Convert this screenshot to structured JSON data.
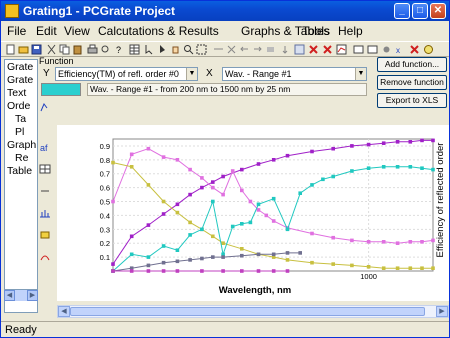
{
  "window": {
    "title": "Grating1 - PCGrate Project"
  },
  "title_buttons": {
    "minimize": "_",
    "maximize": "□",
    "close": "✕"
  },
  "menu": [
    "File",
    "Edit",
    "View",
    "Calcutations & Results",
    "Graphs & Tables",
    "Tools",
    "Help"
  ],
  "function_panel": {
    "group_label": "Function",
    "y_label": "Y",
    "y_select": "Efficiency(TM) of refl. order #0",
    "x_label": "X",
    "x_select": "Wav. - Range #1",
    "range_description": "Wav. - Range #1 - from 200 nm to 1500 nm by 25 nm",
    "series_color": "#2acfcf"
  },
  "side_buttons": {
    "add": "Add function...",
    "remove": "Remove function",
    "export": "Export to XLS"
  },
  "tree": [
    "Grate",
    "Grate",
    "Text",
    "Orde",
    "Ta",
    "Pl",
    "Graph",
    "Re",
    "Table"
  ],
  "status": {
    "text": "Ready"
  },
  "chart_data": {
    "type": "line",
    "xlabel": "Wavelength, nm",
    "ylabel": "Efficiency of reflected order",
    "x_scale": "log",
    "xlim": [
      200,
      1500
    ],
    "ylim": [
      0,
      0.95
    ],
    "y_ticks": [
      0.1,
      0.2,
      0.3,
      0.4,
      0.5,
      0.6,
      0.7,
      0.8,
      0.9
    ],
    "x_tick_labels": [
      "1000"
    ],
    "grid": true,
    "series": [
      {
        "color": "#a020c8",
        "x": [
          200,
          225,
          250,
          275,
          300,
          325,
          350,
          375,
          400,
          450,
          500,
          550,
          600,
          700,
          800,
          900,
          1000,
          1100,
          1200,
          1300,
          1400,
          1500
        ],
        "y": [
          0.05,
          0.25,
          0.33,
          0.41,
          0.48,
          0.55,
          0.6,
          0.64,
          0.68,
          0.73,
          0.77,
          0.8,
          0.83,
          0.86,
          0.88,
          0.9,
          0.91,
          0.92,
          0.93,
          0.93,
          0.94,
          0.94
        ]
      },
      {
        "color": "#e070e0",
        "x": [
          200,
          225,
          250,
          275,
          300,
          325,
          350,
          375,
          400,
          425,
          450,
          475,
          500,
          525,
          550,
          600,
          700,
          800,
          900,
          1000,
          1100,
          1200,
          1300,
          1400,
          1500
        ],
        "y": [
          0.5,
          0.84,
          0.88,
          0.82,
          0.8,
          0.73,
          0.67,
          0.6,
          0.55,
          0.72,
          0.58,
          0.5,
          0.44,
          0.4,
          0.36,
          0.31,
          0.27,
          0.24,
          0.22,
          0.21,
          0.21,
          0.2,
          0.21,
          0.21,
          0.22
        ]
      },
      {
        "color": "#c8c040",
        "x": [
          200,
          225,
          250,
          275,
          300,
          325,
          350,
          375,
          400,
          450,
          500,
          550,
          600,
          700,
          800,
          900,
          1000,
          1100,
          1200,
          1300,
          1400,
          1500
        ],
        "y": [
          0.78,
          0.75,
          0.62,
          0.5,
          0.42,
          0.35,
          0.3,
          0.25,
          0.2,
          0.16,
          0.12,
          0.1,
          0.08,
          0.06,
          0.05,
          0.04,
          0.03,
          0.02,
          0.02,
          0.02,
          0.02,
          0.02
        ]
      },
      {
        "color": "#20c8c0",
        "x": [
          200,
          225,
          250,
          275,
          300,
          325,
          350,
          375,
          400,
          425,
          450,
          475,
          500,
          550,
          600,
          650,
          700,
          750,
          800,
          900,
          1000,
          1100,
          1200,
          1300,
          1400,
          1500
        ],
        "y": [
          0.0,
          0.12,
          0.1,
          0.18,
          0.15,
          0.26,
          0.3,
          0.5,
          0.12,
          0.32,
          0.34,
          0.35,
          0.48,
          0.52,
          0.3,
          0.56,
          0.62,
          0.66,
          0.68,
          0.72,
          0.74,
          0.75,
          0.75,
          0.75,
          0.74,
          0.73
        ]
      },
      {
        "color": "#707090",
        "x": [
          200,
          225,
          250,
          275,
          300,
          325,
          350,
          375,
          400,
          450,
          500,
          550,
          600,
          650
        ],
        "y": [
          0.0,
          0.02,
          0.04,
          0.06,
          0.07,
          0.08,
          0.09,
          0.1,
          0.1,
          0.11,
          0.12,
          0.12,
          0.13,
          0.13
        ]
      },
      {
        "color": "#c040c0",
        "x": [
          200,
          225,
          250,
          275,
          300,
          350,
          400,
          450,
          500,
          550,
          600
        ],
        "y": [
          0.0,
          0.0,
          0.0,
          0.0,
          0.0,
          0.0,
          0.0,
          0.0,
          0.0,
          0.0,
          0.0
        ]
      }
    ]
  }
}
